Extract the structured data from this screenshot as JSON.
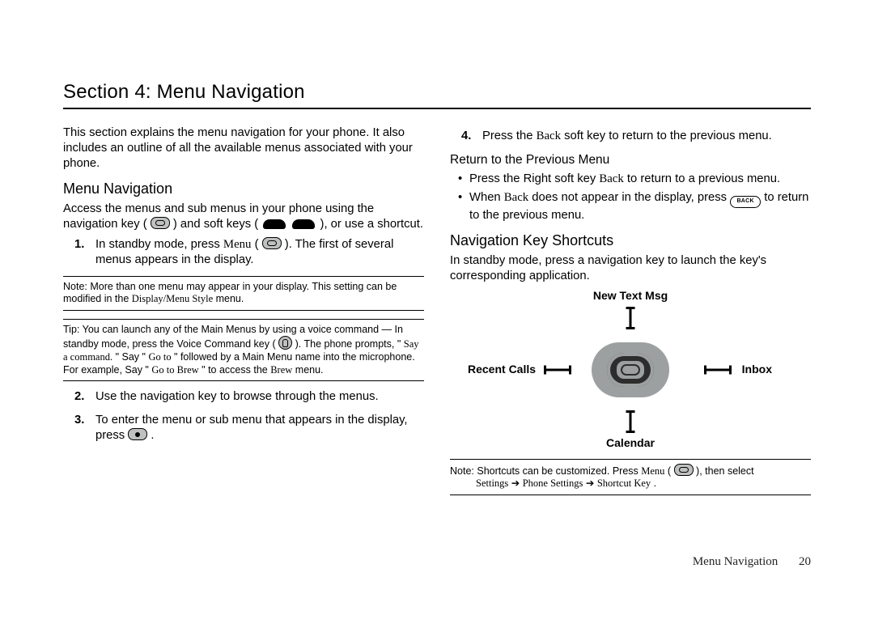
{
  "title": "Section 4: Menu Navigation",
  "intro": "This section explains the menu navigation for your phone. It also includes an outline of all the available menus associated with your phone.",
  "h_menu_nav": "Menu Navigation",
  "access_a": "Access the menus and sub menus in your phone using the navigation key (",
  "access_b": ") and soft keys (",
  "access_c": "), or use a shortcut.",
  "step1_a": "In standby mode, press ",
  "step1_menu": "Menu",
  "step1_b": " (",
  "step1_c": "). The first of several menus appears in the display.",
  "note1_label": "Note:",
  "note1_a": "More than one menu may appear in your display. This setting can be modified in the ",
  "note1_dms": "Display/Menu Style",
  "note1_b": " menu.",
  "tip_label": "Tip:",
  "tip_a": "You can launch any of the Main Menus by using a voice command — In standby mode, press the Voice Command key (",
  "tip_b": "). The phone prompts, \"",
  "tip_say_cmd": "Say a command.",
  "tip_c": "\" Say \"",
  "tip_goto": "Go to",
  "tip_d": "\" followed by a Main Menu name into the microphone. For example, Say \"",
  "tip_gotobrew": "Go to Brew",
  "tip_e": "\" to access the ",
  "tip_brew": "Brew",
  "tip_f": " menu.",
  "step2": "Use the navigation key to browse through the menus.",
  "step3_a": "To enter the menu or sub menu that appears in the display, press ",
  "step3_b": ".",
  "step4_a": "Press the ",
  "step4_back": "Back",
  "step4_b": " soft key to return to the previous menu.",
  "h_return": "Return to the Previous Menu",
  "ret_b1_a": "Press the Right soft key ",
  "ret_b1_back": "Back",
  "ret_b1_b": " to return to a previous menu.",
  "ret_b2_a": "When ",
  "ret_b2_back": "Back",
  "ret_b2_b": " does not appear in the display, press ",
  "ret_b2_key": "BACK",
  "ret_b2_c": " to return to the previous menu.",
  "h_shortcuts": "Navigation Key Shortcuts",
  "shortcuts_p": "In standby mode, press a navigation key to launch the key's corresponding application.",
  "diagram": {
    "top": "New Text Msg",
    "left": "Recent Calls",
    "right": "Inbox",
    "bottom": "Calendar"
  },
  "note2_label": "Note:",
  "note2_a": "Shortcuts can be customized. Press ",
  "note2_menu": "Menu",
  "note2_b": " (",
  "note2_c": "), then select ",
  "note2_path1": "Settings",
  "note2_arrow1": " ➔ ",
  "note2_path2": "Phone Settings",
  "note2_arrow2": " ➔ ",
  "note2_path3": "Shortcut Key",
  "note2_d": ".",
  "footer_text": "Menu Navigation",
  "footer_page": "20"
}
